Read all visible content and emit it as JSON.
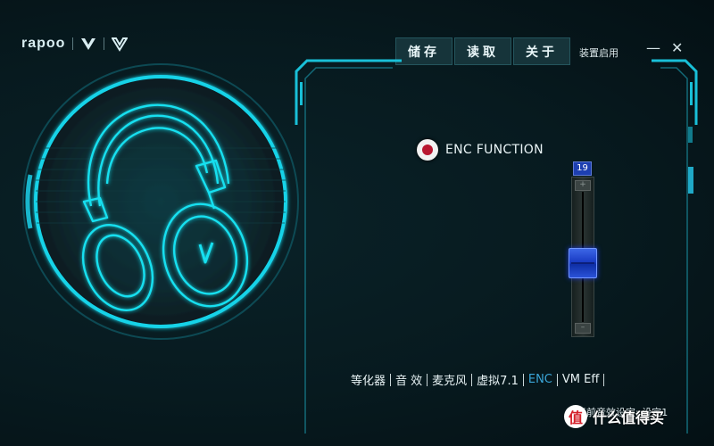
{
  "brand": {
    "name": "rapoo"
  },
  "toolbar": {
    "save_label": "储存",
    "load_label": "读取",
    "about_label": "关于"
  },
  "device_label": "装置启用",
  "window": {
    "minimize": "—",
    "close": "✕"
  },
  "enc": {
    "label": "ENC FUNCTION",
    "enabled": true
  },
  "slider": {
    "value": "19",
    "level": 0.45
  },
  "tabs": [
    {
      "label": "等化器",
      "active": false
    },
    {
      "label": "音 效",
      "active": false
    },
    {
      "label": "麦克风",
      "active": false
    },
    {
      "label": "虚拟7.1",
      "active": false
    },
    {
      "label": "ENC",
      "active": true
    },
    {
      "label": "VM Eff",
      "active": false
    }
  ],
  "status": "当前音效设定: 设定1",
  "watermark": {
    "logo": "值",
    "text": "什么值得买"
  },
  "colors": {
    "accent": "#19d3e8",
    "thumb": "#1a3cc4",
    "enc_dot": "#b81730"
  },
  "icons": {
    "headset": "headset-icon",
    "record": "radio-dot-icon"
  }
}
